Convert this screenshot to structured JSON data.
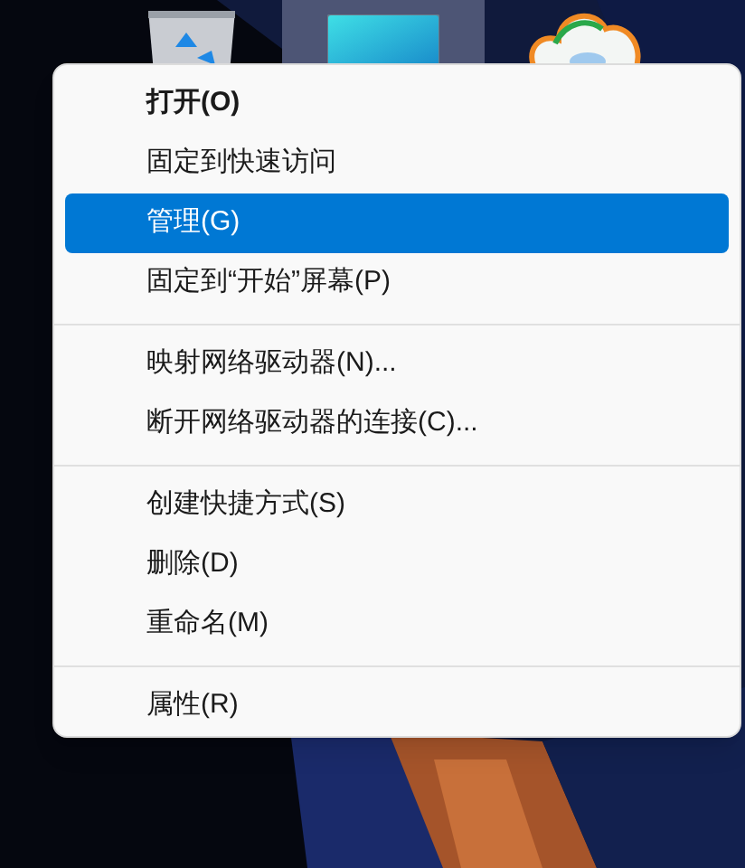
{
  "desktop_icons": [
    {
      "kind": "recycle-bin",
      "selected": false
    },
    {
      "kind": "computer",
      "selected": true
    },
    {
      "kind": "cloud-app",
      "selected": false
    }
  ],
  "context_menu": {
    "items": [
      {
        "kind": "item",
        "label": "打开(O)",
        "bold": true,
        "selected": false
      },
      {
        "kind": "item",
        "label": "固定到快速访问",
        "bold": false,
        "selected": false
      },
      {
        "kind": "item",
        "label": "管理(G)",
        "bold": false,
        "selected": true
      },
      {
        "kind": "item",
        "label": "固定到“开始”屏幕(P)",
        "bold": false,
        "selected": false
      },
      {
        "kind": "separator"
      },
      {
        "kind": "item",
        "label": "映射网络驱动器(N)...",
        "bold": false,
        "selected": false
      },
      {
        "kind": "item",
        "label": "断开网络驱动器的连接(C)...",
        "bold": false,
        "selected": false
      },
      {
        "kind": "separator"
      },
      {
        "kind": "item",
        "label": "创建快捷方式(S)",
        "bold": false,
        "selected": false
      },
      {
        "kind": "item",
        "label": "删除(D)",
        "bold": false,
        "selected": false
      },
      {
        "kind": "item",
        "label": "重命名(M)",
        "bold": false,
        "selected": false
      },
      {
        "kind": "separator"
      },
      {
        "kind": "item",
        "label": "属性(R)",
        "bold": false,
        "selected": false
      }
    ]
  }
}
